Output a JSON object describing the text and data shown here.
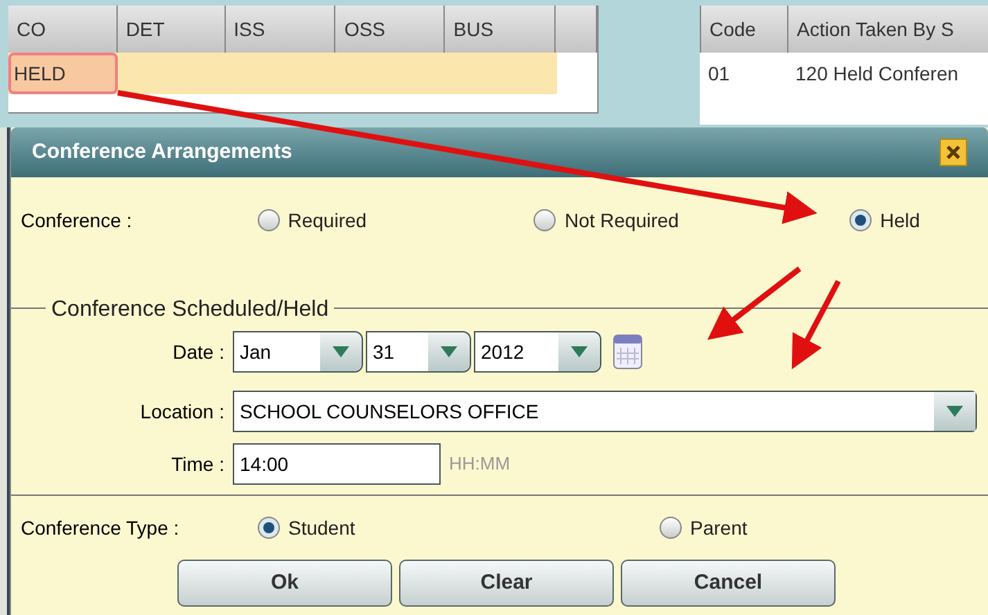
{
  "left_table": {
    "columns": [
      "CO",
      "DET",
      "ISS",
      "OSS",
      "BUS"
    ],
    "rows": [
      {
        "cells": [
          "HELD",
          "",
          "",
          "",
          ""
        ],
        "selected": true
      }
    ]
  },
  "right_table": {
    "columns": [
      "Code",
      "Action Taken By S"
    ],
    "rows": [
      {
        "cells": [
          "01",
          "120 Held Conferen"
        ]
      }
    ]
  },
  "dialog": {
    "title": "Conference Arrangements",
    "conference": {
      "label": "Conference :",
      "options": [
        {
          "label": "Required",
          "selected": false
        },
        {
          "label": "Not Required",
          "selected": false
        },
        {
          "label": "Held",
          "selected": true
        }
      ]
    },
    "fieldset": {
      "legend": "Conference Scheduled/Held",
      "date": {
        "label": "Date :",
        "month": "Jan",
        "day": "31",
        "year": "2012"
      },
      "location": {
        "label": "Location :",
        "value": "SCHOOL COUNSELORS OFFICE"
      },
      "time": {
        "label": "Time :",
        "value": "14:00",
        "hint": "HH:MM"
      }
    },
    "conference_type": {
      "label": "Conference Type :",
      "options": [
        {
          "label": "Student",
          "selected": true
        },
        {
          "label": "Parent",
          "selected": false
        }
      ]
    },
    "buttons": [
      "Ok",
      "Clear",
      "Cancel"
    ]
  }
}
